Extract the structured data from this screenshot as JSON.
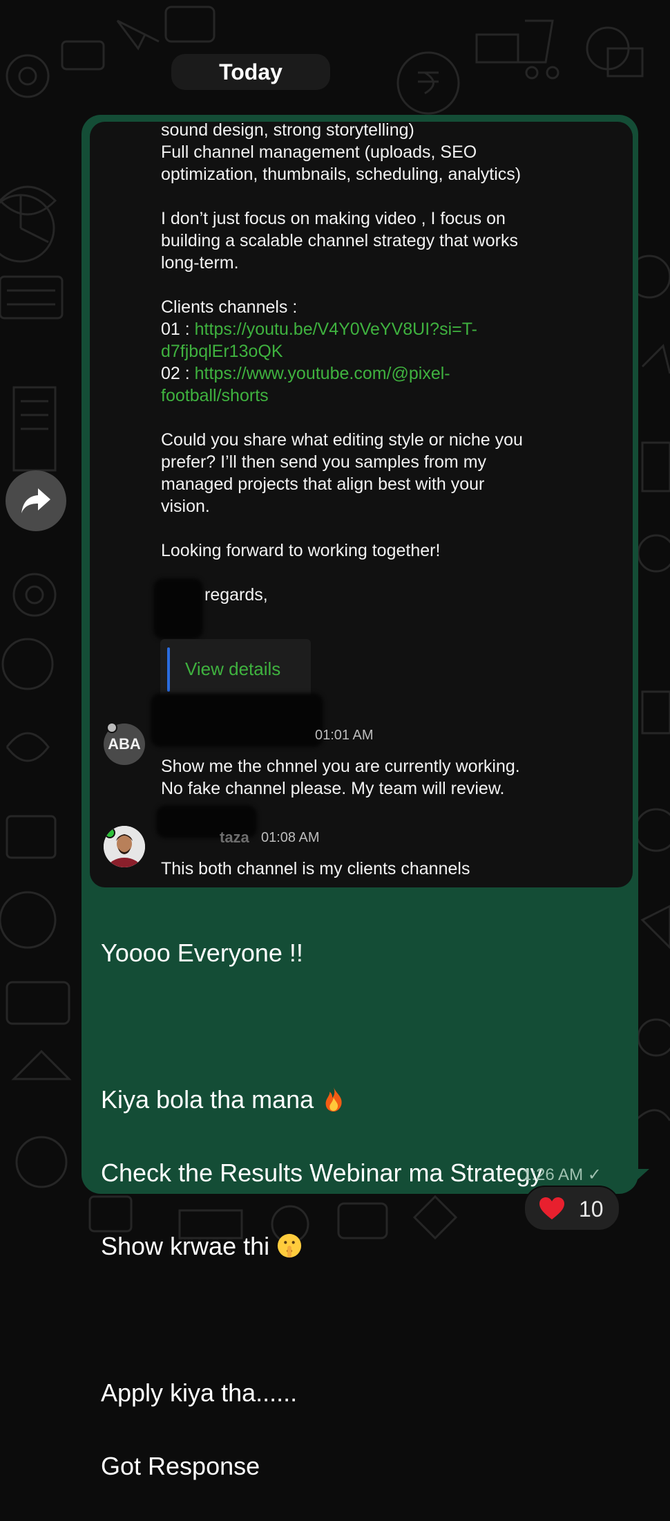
{
  "date_divider": "Today",
  "screenshot": {
    "message_body": {
      "line1": "sound design, strong storytelling)",
      "line2": "Full channel management (uploads, SEO\noptimization, thumbnails, scheduling, analytics)",
      "para2": "I don’t just focus on making video , I focus on\nbuilding a scalable channel strategy that works\nlong-term.",
      "clients_heading": "Clients channels :",
      "client1_label": "01 : ",
      "client1_link": "https://youtu.be/V4Y0VeYV8UI?si=T-\nd7fjbqlEr13oQK",
      "client2_label": "02 : ",
      "client2_link": "https://www.youtube.com/@pixel-\nfootball/shorts",
      "para3": "Could you share what editing style or niche you\nprefer? I’ll then send you samples from my\nmanaged projects that align best with your\nvision.",
      "para4": "Looking forward to working together!",
      "signoff": "regards,"
    },
    "view_details_label": "View details",
    "reply1": {
      "avatar_text": "ABA",
      "time": "01:01 AM",
      "text": "Show me the chnnel you are currently working.\nNo fake channel please. My team will review."
    },
    "reply2": {
      "name_partial": "taza",
      "time": "01:08 AM",
      "text": "This both channel is my clients channels"
    }
  },
  "caption": {
    "line1": "Yoooo Everyone  !!",
    "line2": "Kiya bola tha mana ",
    "line3": "Check the Results Webinar ma Strategy",
    "line4": "Show krwae thi ",
    "line5": "Apply kiya tha......",
    "line6": "Got Response"
  },
  "message_time": "1:26 AM",
  "reaction": {
    "emoji": "heart",
    "count": "10"
  },
  "icons": [
    "forward-icon",
    "fire-emoji",
    "shushing-emoji",
    "heart-emoji",
    "sent-check-icon"
  ],
  "colors": {
    "bubble": "#144d36",
    "link": "#3fb23f",
    "background": "#0c0c0c"
  }
}
